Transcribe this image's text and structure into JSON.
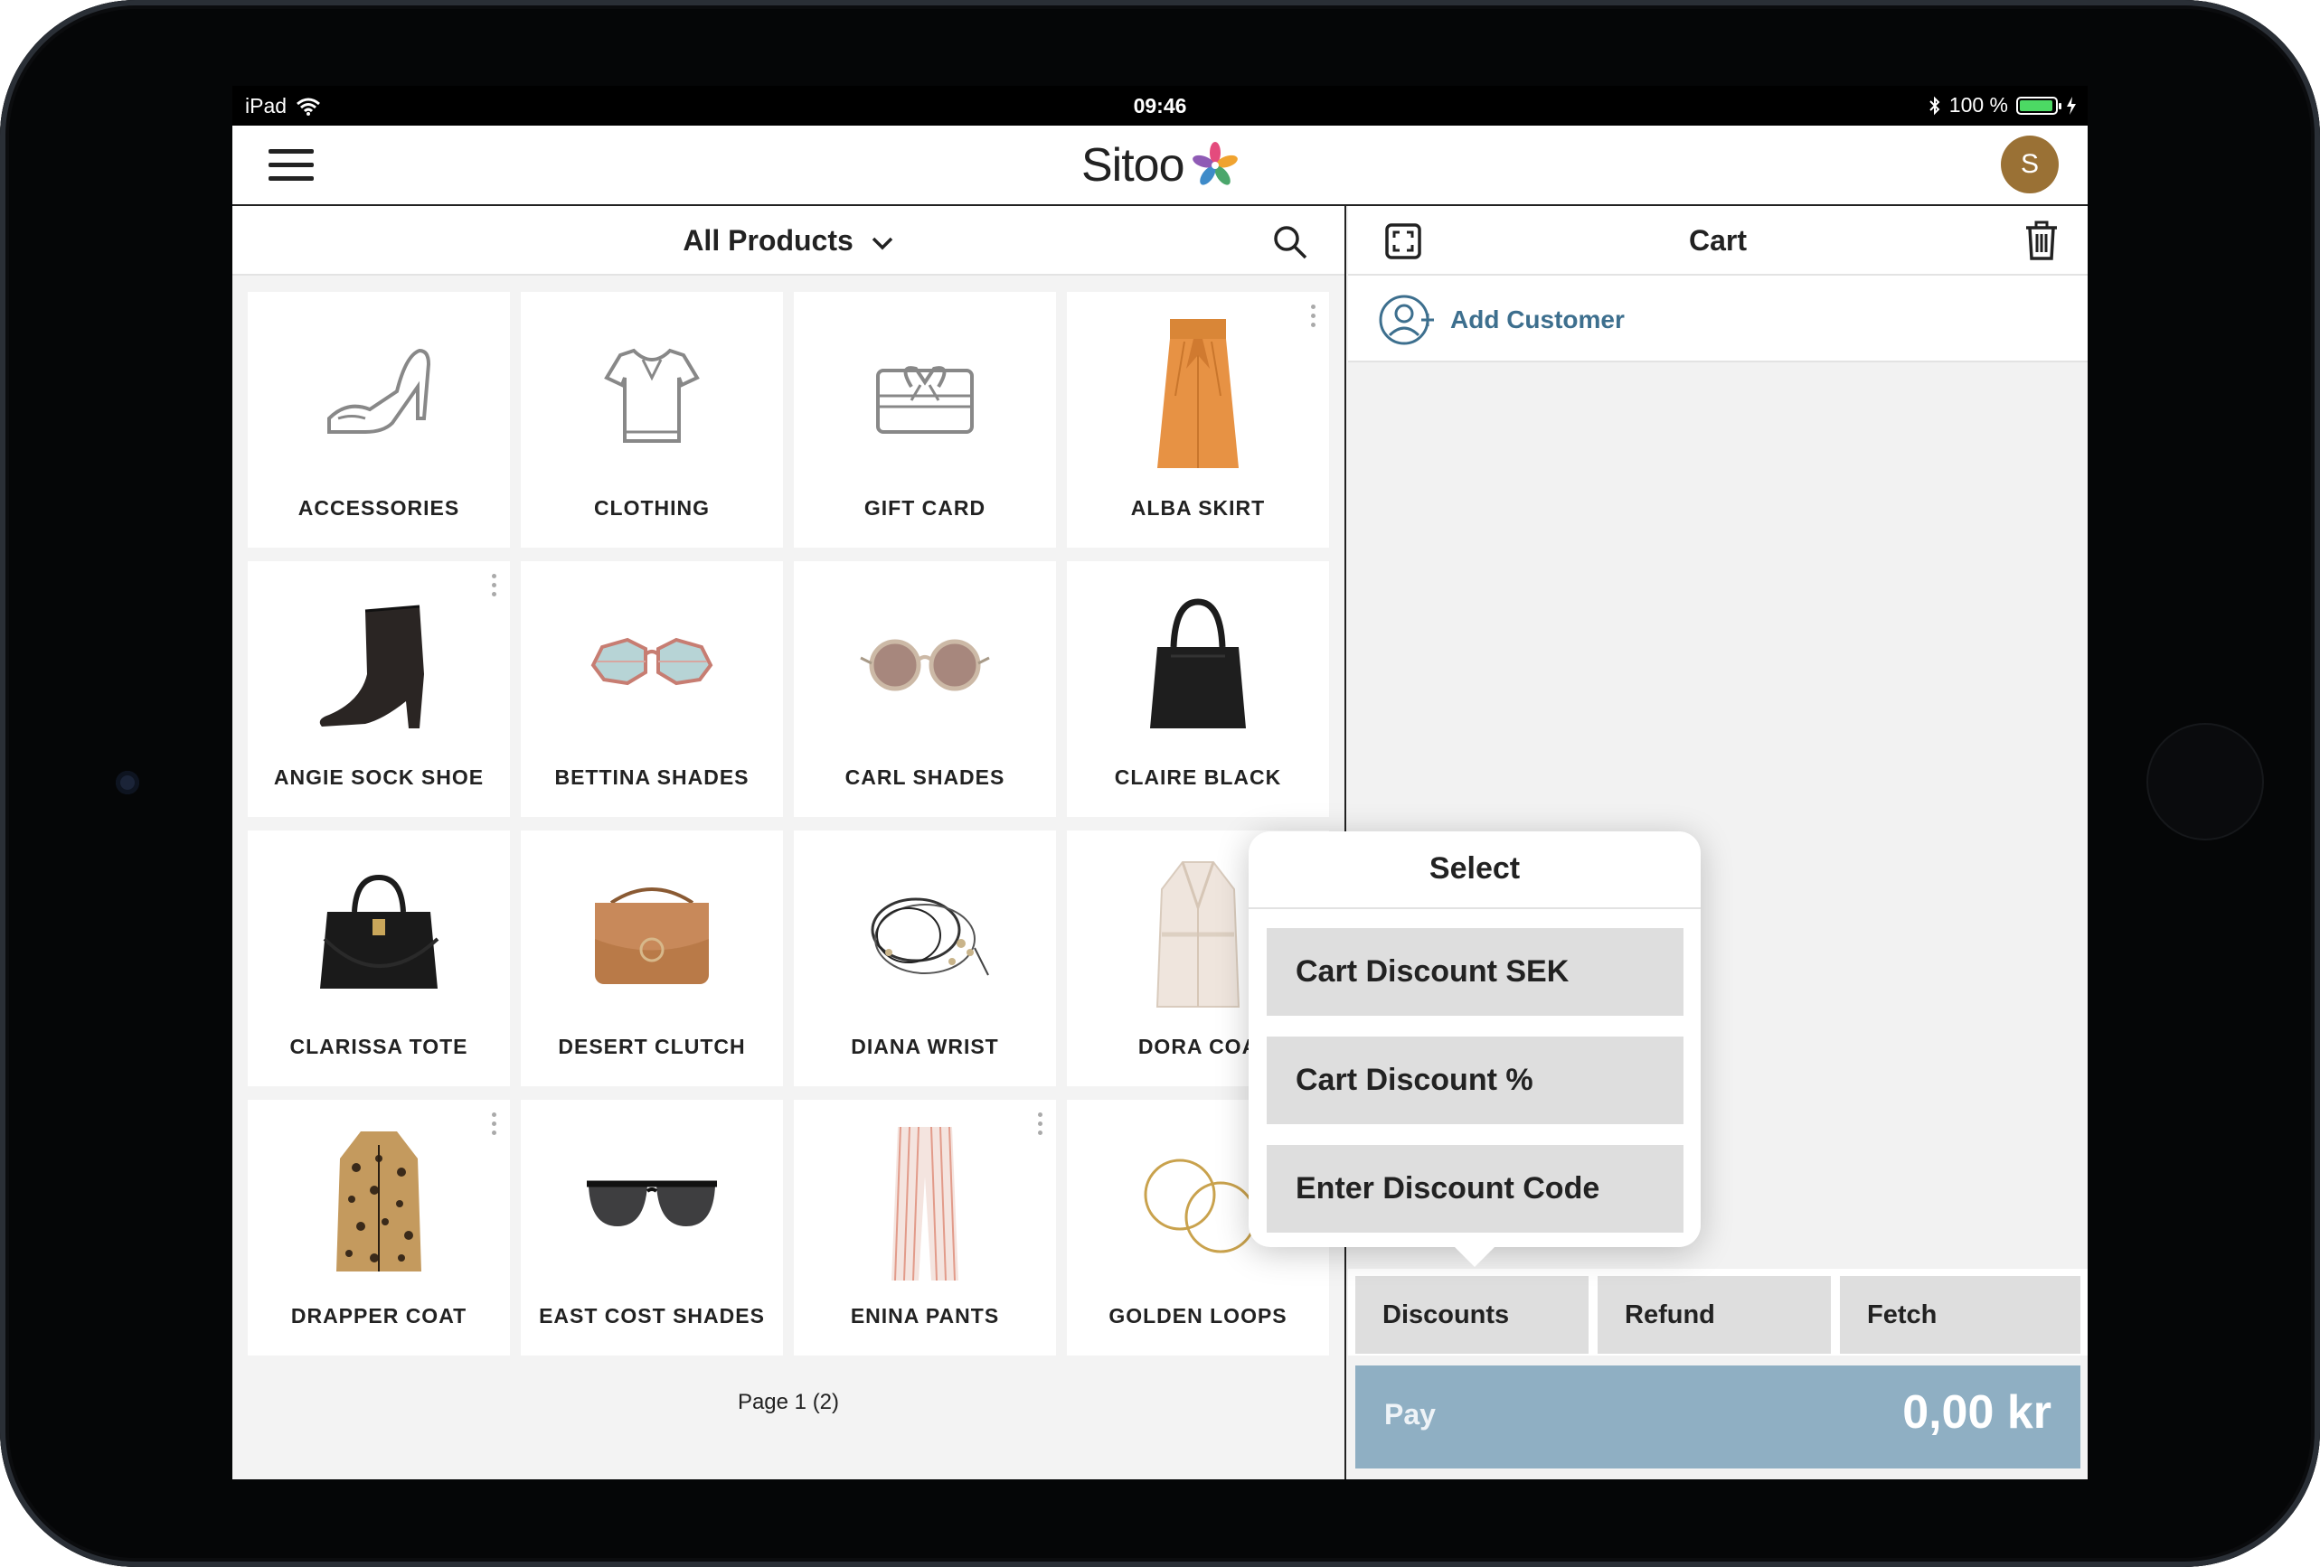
{
  "statusbar": {
    "device": "iPad",
    "time": "09:46",
    "battery": "100 %"
  },
  "header": {
    "logo": "Sitoo",
    "avatar_initial": "S"
  },
  "products": {
    "filter_title": "All Products",
    "items": [
      {
        "label": "ACCESSORIES",
        "icon": "high-heel-shoe-icon"
      },
      {
        "label": "CLOTHING",
        "icon": "polo-shirt-icon"
      },
      {
        "label": "GIFT CARD",
        "icon": "gift-card-icon"
      },
      {
        "label": "ALBA SKIRT",
        "icon": "orange-skirt-image"
      },
      {
        "label": "ANGIE SOCK SHOE",
        "icon": "black-boot-image"
      },
      {
        "label": "BETTINA SHADES",
        "icon": "octagon-sunglasses-image"
      },
      {
        "label": "CARL SHADES",
        "icon": "round-sunglasses-image"
      },
      {
        "label": "CLAIRE BLACK",
        "icon": "black-bag-image"
      },
      {
        "label": "CLARISSA TOTE",
        "icon": "tote-bag-image"
      },
      {
        "label": "DESERT CLUTCH",
        "icon": "brown-clutch-image"
      },
      {
        "label": "DIANA WRIST",
        "icon": "bracelet-image"
      },
      {
        "label": "DORA COA",
        "icon": "trench-coat-image"
      },
      {
        "label": "DRAPPER COAT",
        "icon": "leopard-coat-image"
      },
      {
        "label": "EAST COST SHADES",
        "icon": "black-sunglasses-image"
      },
      {
        "label": "ENINA PANTS",
        "icon": "striped-pants-image"
      },
      {
        "label": "GOLDEN LOOPS",
        "icon": "hoop-earrings-image"
      }
    ],
    "pager": "Page 1 (2)"
  },
  "cart": {
    "title": "Cart",
    "add_customer": "Add Customer",
    "actions": {
      "discounts": "Discounts",
      "refund": "Refund",
      "fetch": "Fetch"
    },
    "pay_label": "Pay",
    "total": "0,00 kr"
  },
  "popover": {
    "title": "Select",
    "options": [
      "Cart Discount SEK",
      "Cart Discount %",
      "Enter Discount Code"
    ]
  },
  "colors": {
    "accent": "#3d6f8e",
    "pay": "#8fafc3",
    "avatar": "#9a7135",
    "button": "#dedede"
  }
}
